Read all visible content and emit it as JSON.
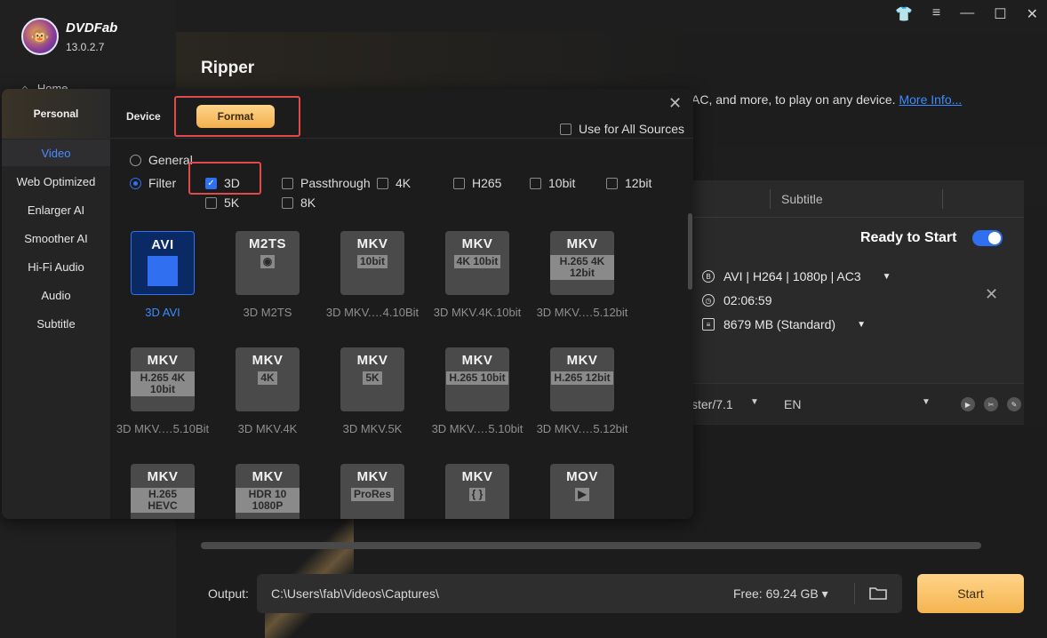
{
  "app": {
    "brand": "DVDFab",
    "version": "13.0.2.7",
    "home_label": "Home"
  },
  "window_controls": [
    "shirt-icon",
    "menu-icon",
    "minimize-icon",
    "maximize-icon",
    "close-icon"
  ],
  "page": {
    "title": "Ripper",
    "description": "AC, and more, to play on any device.",
    "more_info": "More Info..."
  },
  "task": {
    "subtitle_col": "Subtitle",
    "ready": "Ready to Start",
    "profile": "AVI | H264 | 1080p | AC3",
    "duration": "02:06:59",
    "size": "8679 MB (Standard)",
    "audio": "ster/7.1",
    "subtitle_lang": "EN"
  },
  "output": {
    "label": "Output:",
    "path": "C:\\Users\\fab\\Videos\\Captures\\",
    "free": "Free: 69.24 GB",
    "start": "Start"
  },
  "dialog": {
    "personal": "Personal",
    "categories": [
      "Video",
      "Web Optimized",
      "Enlarger AI",
      "Smoother AI",
      "Hi-Fi Audio",
      "Audio",
      "Subtitle"
    ],
    "active_category": "Video",
    "tabs": {
      "device": "Device",
      "format": "Format"
    },
    "use_all": "Use for All Sources",
    "general": "General",
    "filter": "Filter",
    "filters": {
      "f3d": "3D",
      "passthrough": "Passthrough",
      "f4k": "4K",
      "h265": "H265",
      "f10bit": "10bit",
      "f12bit": "12bit",
      "f5k": "5K",
      "f8k": "8K"
    },
    "tiles": [
      {
        "t1": "AVI",
        "badge": "",
        "label": "3D AVI"
      },
      {
        "t1": "M2TS",
        "badge": "◉",
        "label": "3D M2TS"
      },
      {
        "t1": "MKV",
        "badge": "10bit",
        "label": "3D MKV.…4.10Bit"
      },
      {
        "t1": "MKV",
        "badge": "4K 10bit",
        "label": "3D MKV.4K.10bit"
      },
      {
        "t1": "MKV",
        "badge": "H.265 4K 12bit",
        "label": "3D MKV.…5.12bit"
      },
      {
        "t1": "MKV",
        "badge": "H.265 4K 10bit",
        "label": "3D MKV.…5.10Bit"
      },
      {
        "t1": "MKV",
        "badge": "4K",
        "label": "3D MKV.4K"
      },
      {
        "t1": "MKV",
        "badge": "5K",
        "label": "3D MKV.5K"
      },
      {
        "t1": "MKV",
        "badge": "H.265 10bit",
        "label": "3D MKV.…5.10bit"
      },
      {
        "t1": "MKV",
        "badge": "H.265 12bit",
        "label": "3D MKV.…5.12bit"
      },
      {
        "t1": "MKV",
        "badge": "H.265 HEVC",
        "label": ""
      },
      {
        "t1": "MKV",
        "badge": "HDR 10 1080P",
        "label": ""
      },
      {
        "t1": "MKV",
        "badge": "ProRes",
        "label": ""
      },
      {
        "t1": "MKV",
        "badge": "{ }",
        "label": ""
      },
      {
        "t1": "MOV",
        "badge": "▶",
        "label": ""
      }
    ]
  }
}
